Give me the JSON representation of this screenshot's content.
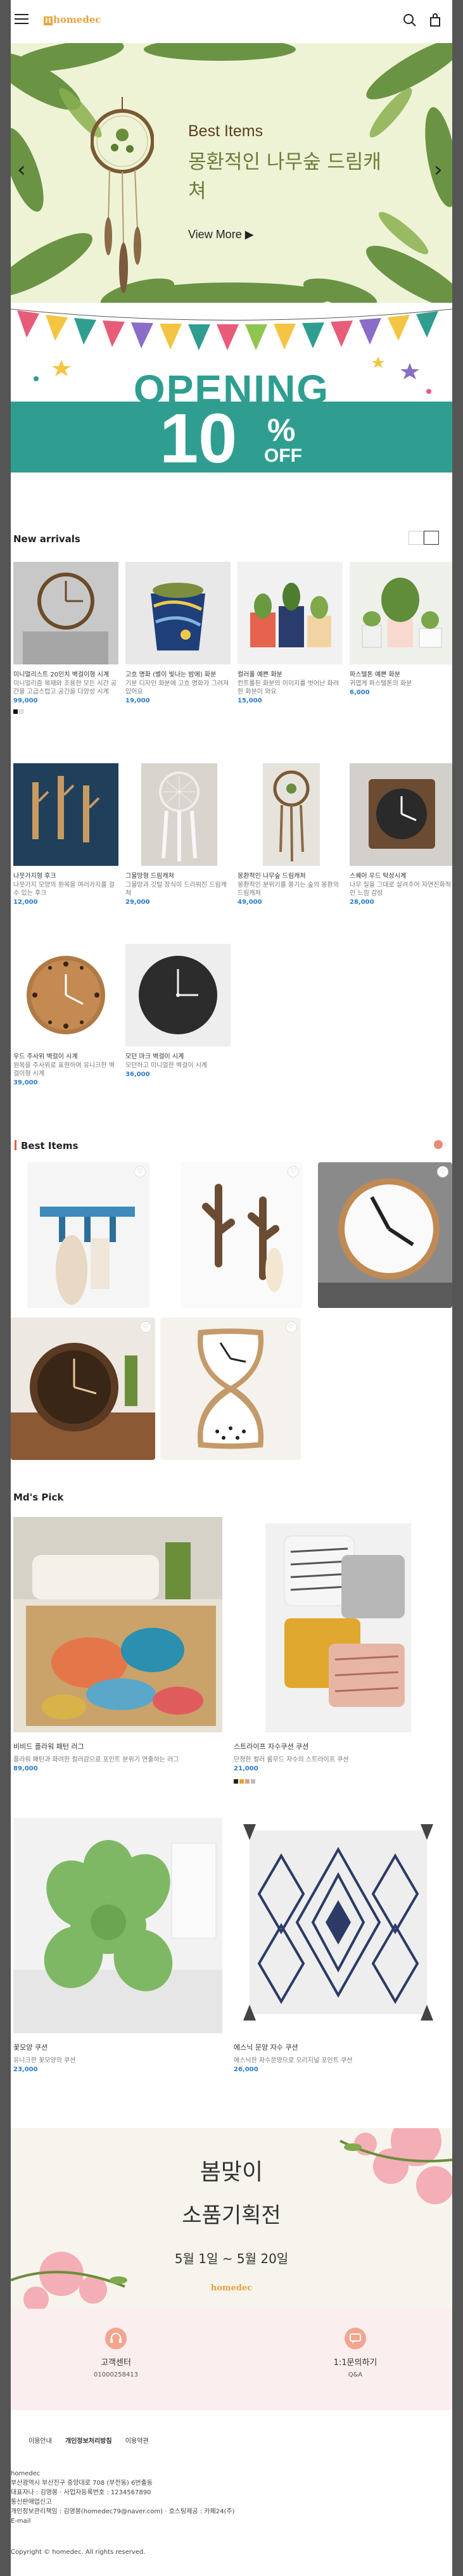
{
  "header": {
    "logo_text": "homedec",
    "logo_letter": "H",
    "menu_icon": "hamburger-menu-icon",
    "search_icon": "search-icon",
    "cart_icon": "shopping-bag-icon"
  },
  "hero": {
    "subtitle": "Best Items",
    "title": "몽환적인 나무숲 드림캐쳐",
    "more_label": "View More ▶",
    "prev": "‹",
    "next": "›"
  },
  "opening": {
    "word": "OPENING",
    "number": "10",
    "percent": "%",
    "off": "OFF"
  },
  "new_arrivals": {
    "title": "New arrivals",
    "items": [
      {
        "name": "미니멀리스트 20인치 벽걸이형 시계",
        "desc": "미니멀리즘 목재와 조용한 모든 시간 공간을 고급스럽고 공간을 다양성 시계",
        "price": "99,000",
        "swatches": [
          "#111111",
          "#e9e9e9"
        ]
      },
      {
        "name": "고흐 명화 (별이 빛나는 밤에) 화분",
        "desc": "기분 디자인 화분에 고흐 명화가 그려져있어요",
        "price": "19,000",
        "swatches": []
      },
      {
        "name": "컬러풀 예쁜 화분",
        "desc": "컨트롤된 화분의 이미지를 벗어난 화려한 화분이 와요",
        "price": "15,000",
        "swatches": []
      },
      {
        "name": "파스텔톤 예쁜 화분",
        "desc": "귀엽게 파스텔톤의 화분",
        "price": "6,000",
        "swatches": []
      },
      {
        "name": "나뭇가지형 후크",
        "desc": "나뭇가지 모양의 원목을 여러가지를 걸 수 있는 후크",
        "price": "12,000",
        "swatches": []
      },
      {
        "name": "그물망형 드림캐쳐",
        "desc": "그물망과 깃털 장식이 드리워진 드림캐쳐",
        "price": "29,000",
        "swatches": []
      },
      {
        "name": "몽환적인 나무숲 드림캐쳐",
        "desc": "몽환적인 분위기를 풍기는 숲의 몽환의 드림캐쳐",
        "price": "49,000",
        "swatches": []
      },
      {
        "name": "스퀘어 우드 탁상시계",
        "desc": "나무 질을 그대로 살려주어 자연친화적인 느낌 감성",
        "price": "28,000",
        "swatches": []
      },
      {
        "name": "우드 주사위 벽걸이 시계",
        "desc": "원목을 주사위로 표현하여 유니크한 벽걸이형 시계",
        "price": "39,000",
        "swatches": []
      },
      {
        "name": "모던 마크 벽걸이 시계",
        "desc": "모던하고 미니멀한 벽걸이 시계",
        "price": "36,000",
        "swatches": []
      }
    ]
  },
  "best_items": {
    "title": "Best Items",
    "items": [
      {
        "alt": "바다 후크 걸이"
      },
      {
        "alt": "선인장 후크"
      },
      {
        "alt": "원목 벽시계"
      },
      {
        "alt": "우드 탁상시계"
      },
      {
        "alt": "모래시계형 시계"
      }
    ]
  },
  "mds_pick": {
    "title": "Md's Pick",
    "items": [
      {
        "name": "비비드 플라워 패턴 러그",
        "desc": "플라워 패턴과 화려한 컬러감으로 포인트 분위기 연출하는 러그",
        "price": "89,000",
        "swatches": []
      },
      {
        "name": "스트라이프 자수쿠션 쿠션",
        "desc": "단정한 컬러 룸무드 자수의 스트라이프 쿠션",
        "price": "21,000",
        "swatches": [
          "#222222",
          "#e0a82e",
          "#e29a9a",
          "#bbbbbb"
        ]
      },
      {
        "name": "꽃모양 쿠션",
        "desc": "유니크한 꽃모양의 쿠션",
        "price": "23,000",
        "swatches": []
      },
      {
        "name": "에스닉 문양 자수 쿠션",
        "desc": "에스닉한 자수문양으로 오리지널 포인트 쿠션",
        "price": "26,000",
        "swatches": []
      }
    ]
  },
  "spring_banner": {
    "line1": "봄맞이",
    "line2": "소품기획전",
    "date": "5월 1일 ~ 5월 20일",
    "logo": "homedec"
  },
  "customer_service": {
    "center_title": "고객센터",
    "center_phone": "01000258413",
    "inquiry_title": "1:1문의하기",
    "inquiry_sub": "Q&A"
  },
  "footer": {
    "links": [
      "이용안내",
      "개인정보처리방침",
      "이용약관"
    ],
    "info": [
      "homedec",
      "부산광역시 부산진구 중앙대로 708 (부전동) 6번출동",
      "대표자나 : 김영봉 · 사업자등록번호 : 1234567890",
      "통신판매업신고",
      "개인정보관리책임 : 김영봉(homedec79@naver.com) · 호스팅제공 : 카페24(주)",
      "E-mail"
    ],
    "copyright": "Copyright © homedec. All rights reserved."
  }
}
